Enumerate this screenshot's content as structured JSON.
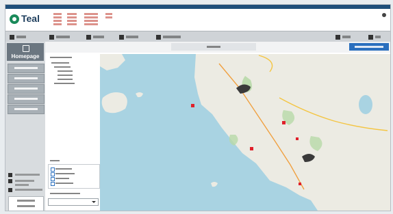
{
  "app": {
    "logo_text": "Teal"
  },
  "sidebar": {
    "home_label": "Homepage"
  },
  "map": {
    "markers": [
      {
        "kind": "square",
        "color": "#e0202a"
      },
      {
        "kind": "square",
        "color": "#e0202a"
      },
      {
        "kind": "square",
        "color": "#e0202a"
      },
      {
        "kind": "square",
        "color": "#e0202a"
      },
      {
        "kind": "square",
        "color": "#e0202a"
      },
      {
        "kind": "site",
        "color": "#333333"
      },
      {
        "kind": "site",
        "color": "#333333"
      }
    ]
  },
  "colors": {
    "header_bar": "#1f4f7a",
    "accent_green": "#1a8a5a",
    "menubar": "#cfd3d7",
    "sidebar": "#d8dcdf",
    "sidebar_buttons": "#a8b0b6",
    "tab_button": "#2a6fbe",
    "sea": "#a9d3e2",
    "land": "#ecebe3",
    "marker": "#e0202a"
  }
}
